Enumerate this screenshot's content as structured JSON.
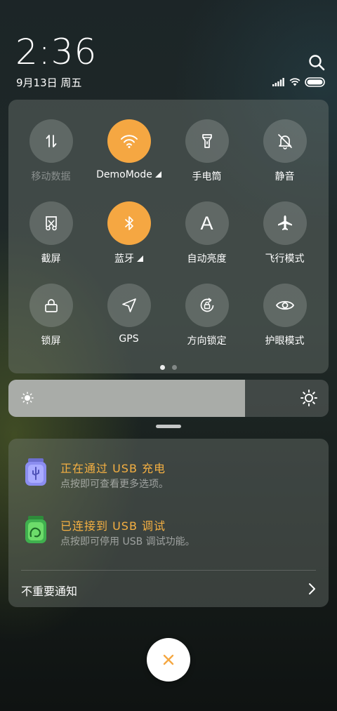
{
  "status_bar": {
    "time": "2:36",
    "date": "9月13日 周五",
    "icons": [
      "signal-icon",
      "wifi-icon",
      "battery-icon"
    ]
  },
  "quick_settings": {
    "tiles": [
      {
        "label": "移动数据",
        "icon": "mobile-data-icon",
        "active": false,
        "disabled": true
      },
      {
        "label": "DemoMode",
        "icon": "wifi-icon",
        "active": true,
        "expand": true
      },
      {
        "label": "手电筒",
        "icon": "flashlight-icon",
        "active": false
      },
      {
        "label": "静音",
        "icon": "mute-bell-icon",
        "active": false
      },
      {
        "label": "截屏",
        "icon": "screenshot-icon",
        "active": false
      },
      {
        "label": "蓝牙",
        "icon": "bluetooth-icon",
        "active": true,
        "expand": true
      },
      {
        "label": "自动亮度",
        "icon": "auto-brightness-icon",
        "active": false
      },
      {
        "label": "飞行模式",
        "icon": "airplane-icon",
        "active": false
      },
      {
        "label": "锁屏",
        "icon": "lock-icon",
        "active": false
      },
      {
        "label": "GPS",
        "icon": "gps-icon",
        "active": false
      },
      {
        "label": "方向锁定",
        "icon": "rotation-lock-icon",
        "active": false
      },
      {
        "label": "护眼模式",
        "icon": "eye-icon",
        "active": false
      }
    ],
    "active_color": "#f5a742",
    "page_count": 2,
    "current_page": 1
  },
  "brightness": {
    "level": 0.74
  },
  "notifications": [
    {
      "title": "正在通过 USB 充电",
      "subtitle": "点按即可查看更多选项。",
      "icon": "usb-charging-jar-icon"
    },
    {
      "title": "已连接到 USB 调试",
      "subtitle": "点按即可停用 USB 调试功能。",
      "icon": "usb-debug-jar-icon"
    }
  ],
  "unimportant_label": "不重要通知",
  "accent_color": "#f5b042"
}
